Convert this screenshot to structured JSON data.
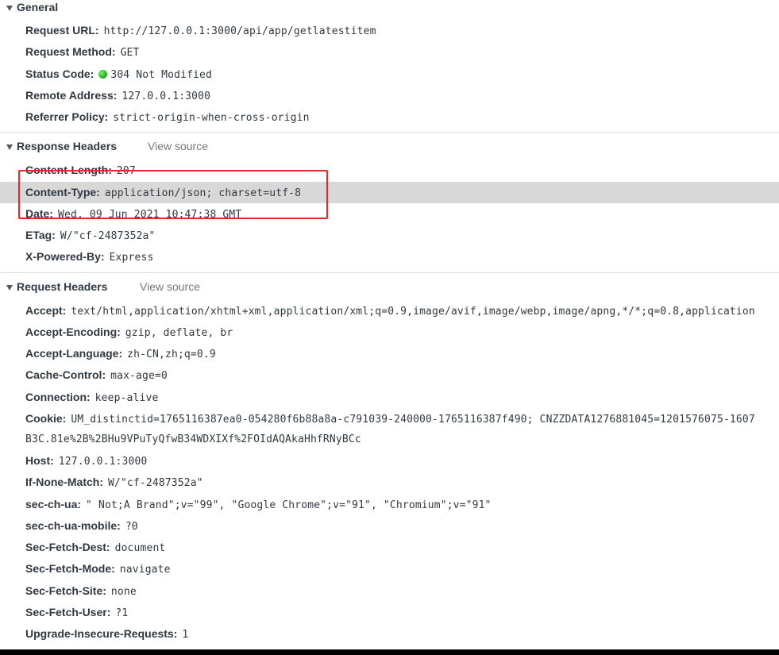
{
  "general": {
    "title": "General",
    "rows": [
      {
        "key": "Request URL:",
        "value": "http://127.0.0.1:3000/api/app/getlatestitem"
      },
      {
        "key": "Request Method:",
        "value": "GET"
      },
      {
        "key": "Status Code:",
        "value": "304 Not Modified",
        "status_color": "#2fb82a",
        "status_icon": "green-dot-icon"
      },
      {
        "key": "Remote Address:",
        "value": "127.0.0.1:3000"
      },
      {
        "key": "Referrer Policy:",
        "value": "strict-origin-when-cross-origin"
      }
    ]
  },
  "response_headers": {
    "title": "Response Headers",
    "view_source": "View source",
    "rows": [
      {
        "key": "Content-Length:",
        "value": "207"
      },
      {
        "key": "Content-Type:",
        "value": "application/json; charset=utf-8"
      },
      {
        "key": "Date:",
        "value": "Wed, 09 Jun 2021 10:47:38 GMT"
      },
      {
        "key": "ETag:",
        "value": "W/\"cf-2487352a\""
      },
      {
        "key": "X-Powered-By:",
        "value": "Express"
      }
    ]
  },
  "request_headers": {
    "title": "Request Headers",
    "view_source": "View source",
    "rows": [
      {
        "key": "Accept:",
        "value": "text/html,application/xhtml+xml,application/xml;q=0.9,image/avif,image/webp,image/apng,*/*;q=0.8,application"
      },
      {
        "key": "Accept-Encoding:",
        "value": "gzip, deflate, br"
      },
      {
        "key": "Accept-Language:",
        "value": "zh-CN,zh;q=0.9"
      },
      {
        "key": "Cache-Control:",
        "value": "max-age=0"
      },
      {
        "key": "Connection:",
        "value": "keep-alive"
      },
      {
        "key": "Cookie:",
        "value": "UM_distinctid=1765116387ea0-054280f6b88a8a-c791039-240000-1765116387f490; CNZZDATA1276881045=1201576075-1607",
        "continuation": "B3C.81e%2B%2BHu9VPuTyQfwB34WDXIXf%2FOIdAQAkaHhfRNyBCc"
      },
      {
        "key": "Host:",
        "value": "127.0.0.1:3000"
      },
      {
        "key": "If-None-Match:",
        "value": "W/\"cf-2487352a\""
      },
      {
        "key": "sec-ch-ua:",
        "value": "\" Not;A Brand\";v=\"99\", \"Google Chrome\";v=\"91\", \"Chromium\";v=\"91\""
      },
      {
        "key": "sec-ch-ua-mobile:",
        "value": "?0"
      },
      {
        "key": "Sec-Fetch-Dest:",
        "value": "document"
      },
      {
        "key": "Sec-Fetch-Mode:",
        "value": "navigate"
      },
      {
        "key": "Sec-Fetch-Site:",
        "value": "none"
      },
      {
        "key": "Sec-Fetch-User:",
        "value": "?1"
      },
      {
        "key": "Upgrade-Insecure-Requests:",
        "value": "1"
      }
    ]
  },
  "annotation": {
    "box_color": "#e02a2a"
  },
  "colors": {
    "highlight_row": "#d8d8d8",
    "text": "#303942",
    "muted": "#777777"
  }
}
